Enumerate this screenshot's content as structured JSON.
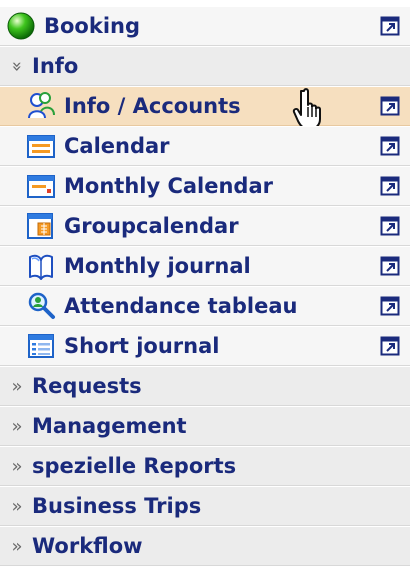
{
  "menu": {
    "booking": {
      "label": "Booking",
      "icon": "green-ball-icon"
    },
    "info": {
      "label": "Info",
      "expanded": true,
      "items": [
        {
          "label": "Info / Accounts",
          "icon": "accounts-icon",
          "active": true
        },
        {
          "label": "Calendar",
          "icon": "calendar-icon"
        },
        {
          "label": "Monthly Calendar",
          "icon": "monthly-calendar-icon"
        },
        {
          "label": "Groupcalendar",
          "icon": "group-calendar-icon"
        },
        {
          "label": "Monthly journal",
          "icon": "book-icon"
        },
        {
          "label": "Attendance tableau",
          "icon": "magnifier-person-icon"
        },
        {
          "label": "Short journal",
          "icon": "list-icon"
        }
      ]
    },
    "sections": [
      {
        "label": "Requests"
      },
      {
        "label": "Management"
      },
      {
        "label": "spezielle Reports"
      },
      {
        "label": "Business Trips"
      },
      {
        "label": "Workflow"
      }
    ]
  },
  "colors": {
    "text": "#1a2a7c",
    "active_background": "#f6dfbf",
    "section_background": "#ececec"
  }
}
